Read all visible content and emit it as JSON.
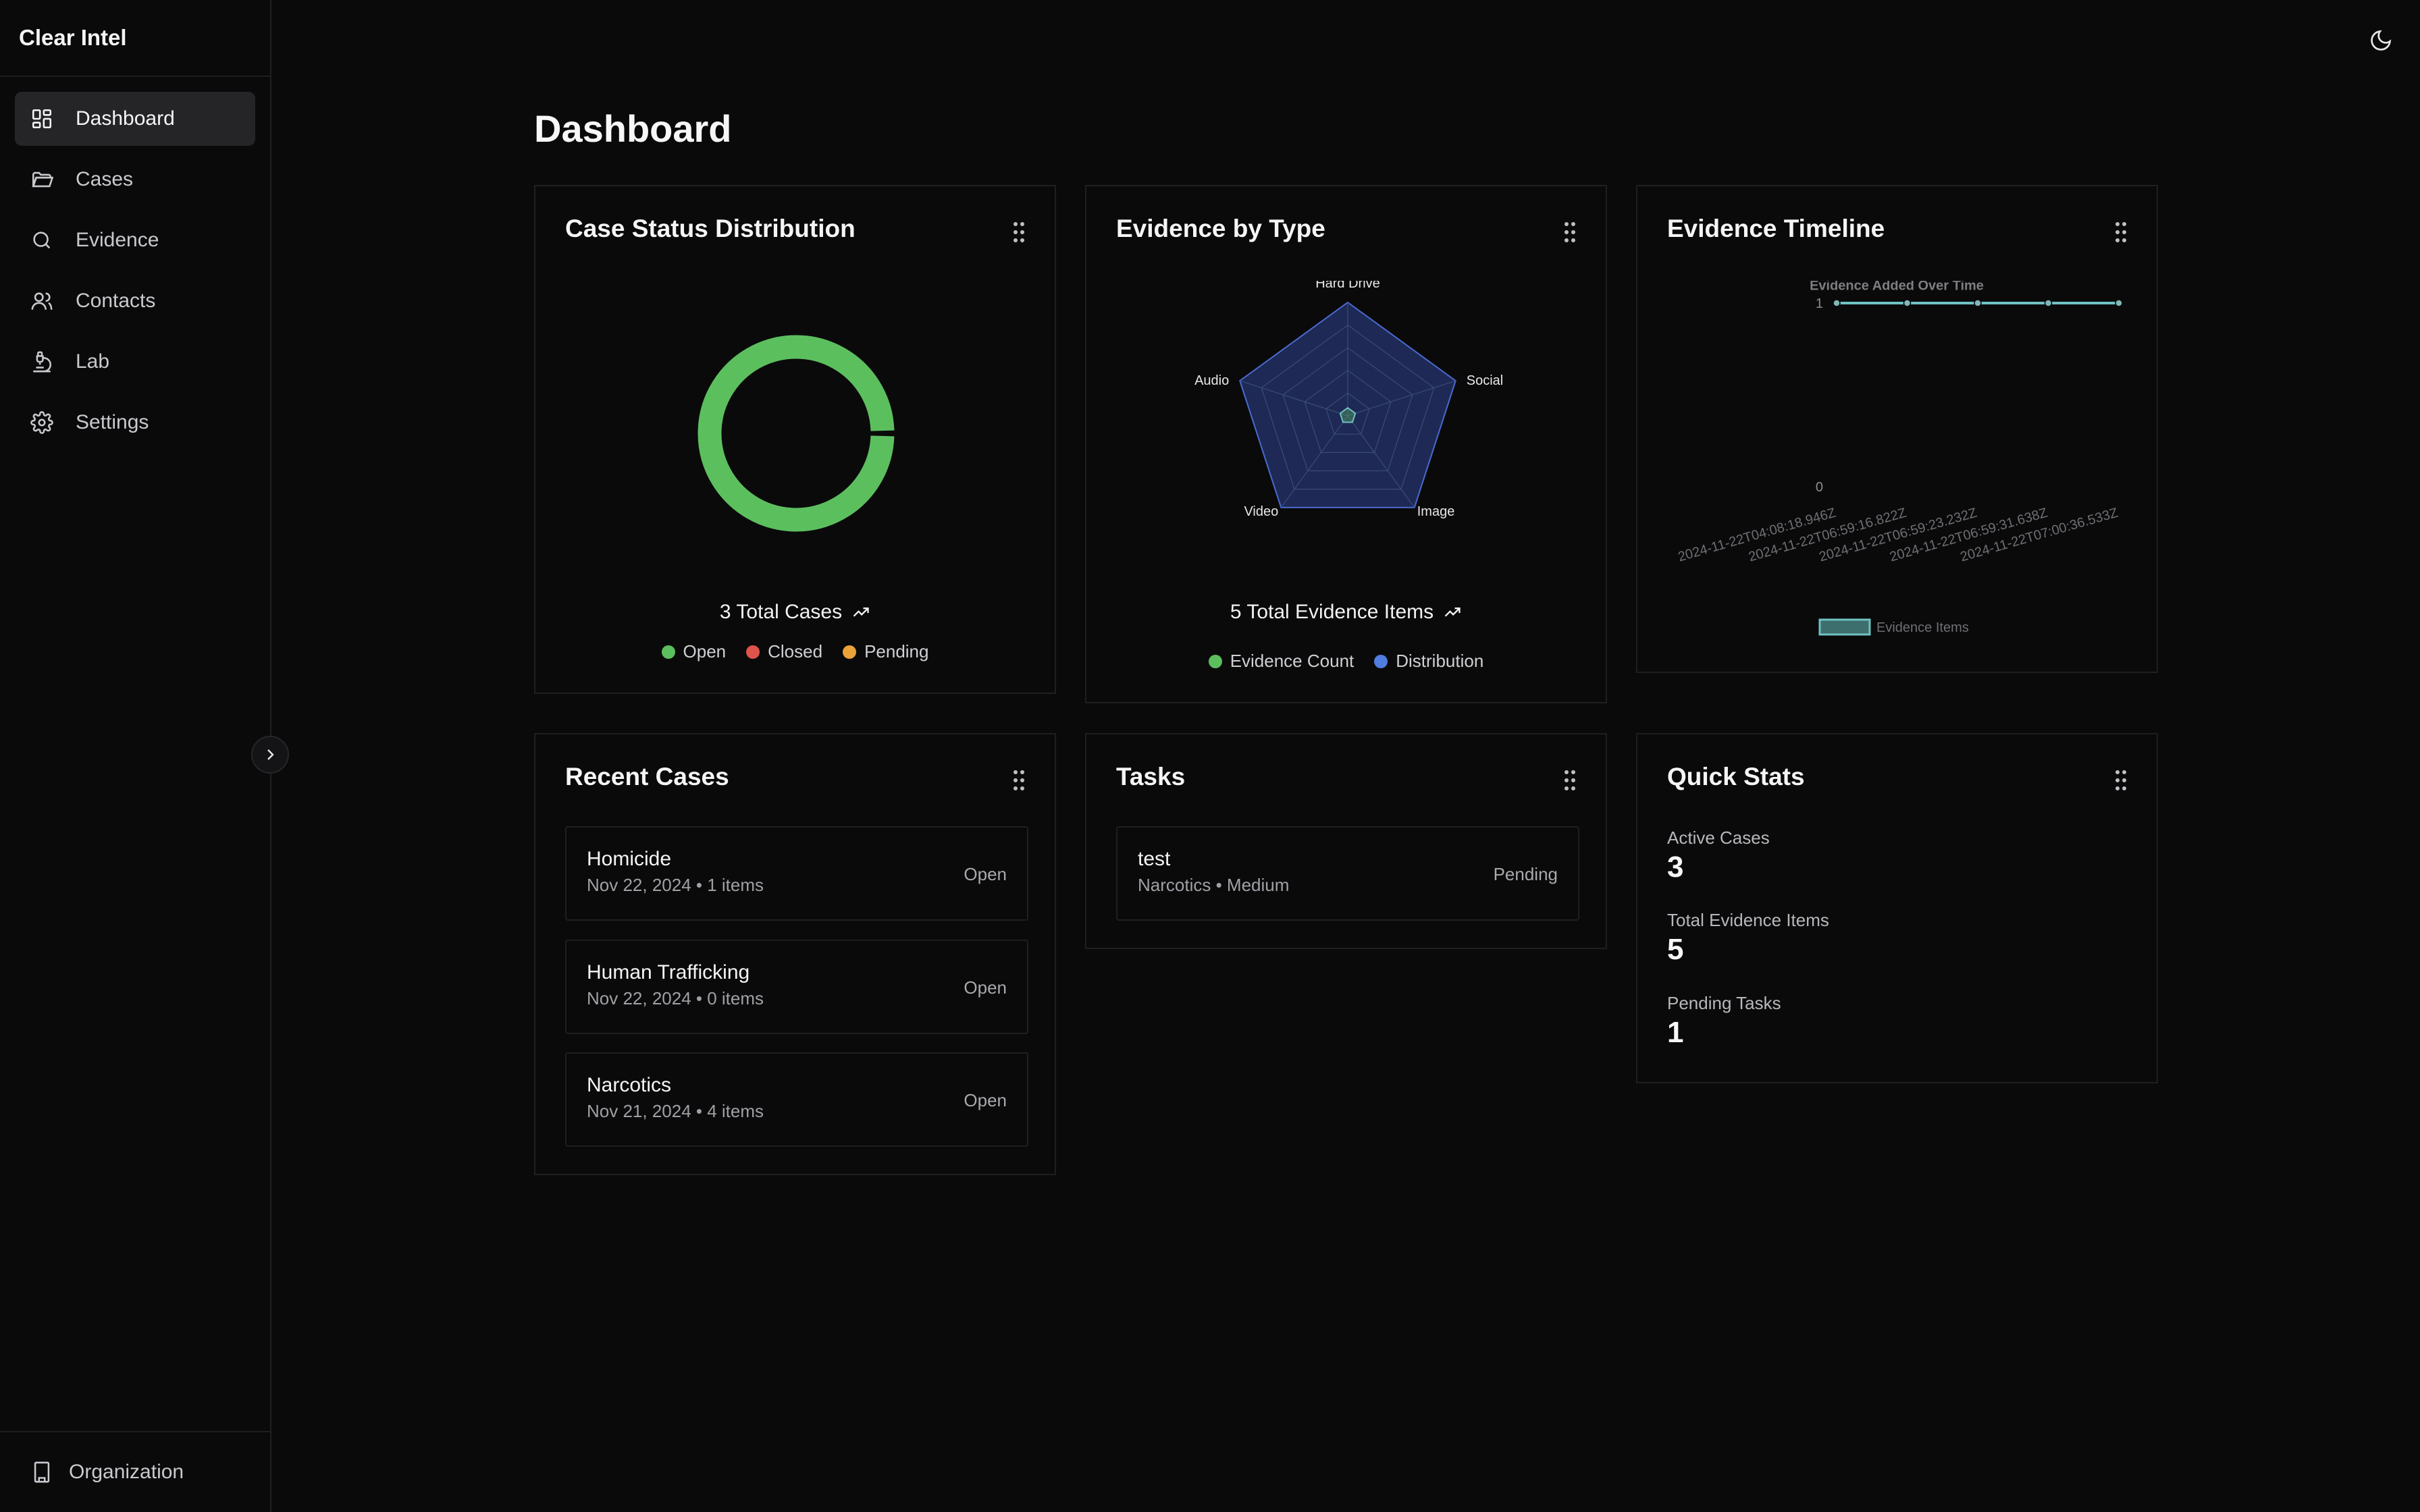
{
  "app": {
    "title": "Clear Intel"
  },
  "sidebar": {
    "items": [
      {
        "label": "Dashboard",
        "icon": "dashboard-icon",
        "active": true
      },
      {
        "label": "Cases",
        "icon": "folder-icon"
      },
      {
        "label": "Evidence",
        "icon": "search-icon"
      },
      {
        "label": "Contacts",
        "icon": "users-icon"
      },
      {
        "label": "Lab",
        "icon": "microscope-icon"
      },
      {
        "label": "Settings",
        "icon": "gear-icon"
      }
    ],
    "footer": {
      "label": "Organization",
      "icon": "building-icon"
    }
  },
  "page": {
    "title": "Dashboard"
  },
  "colors": {
    "open": "#5cbf5e",
    "closed": "#e0534a",
    "pending": "#eaa23a",
    "evidence_count": "#5cbf5e",
    "distribution": "#4f7de0",
    "timeline": "#6fc2c2",
    "radar_fill": "#1e2a55",
    "radar_stroke": "#4a6ad0"
  },
  "case_status": {
    "title": "Case Status Distribution",
    "total_label": "3 Total Cases",
    "legend": [
      "Open",
      "Closed",
      "Pending"
    ]
  },
  "evidence_type": {
    "title": "Evidence by Type",
    "total_label": "5 Total Evidence Items",
    "legend": [
      "Evidence Count",
      "Distribution"
    ]
  },
  "timeline": {
    "title": "Evidence Timeline",
    "chart_title": "Evidence Added Over Time",
    "legend_label": "Evidence Items"
  },
  "chart_data": [
    {
      "type": "pie",
      "title": "",
      "categories": [
        "Open",
        "Closed",
        "Pending"
      ],
      "values": [
        3,
        0,
        0
      ]
    },
    {
      "type": "radar",
      "title": "",
      "categories": [
        "Hard Drive",
        "Social",
        "Image",
        "Video",
        "Audio"
      ],
      "series": [
        {
          "name": "Evidence Count",
          "values": [
            0,
            0,
            0,
            0,
            0
          ]
        },
        {
          "name": "Distribution",
          "values": [
            1,
            1,
            1,
            1,
            1
          ]
        }
      ]
    },
    {
      "type": "line",
      "title": "Evidence Added Over Time",
      "x": [
        "2024-11-22T04:08:18.946Z",
        "2024-11-22T06:59:16.822Z",
        "2024-11-22T06:59:23.232Z",
        "2024-11-22T06:59:31.638Z",
        "2024-11-22T07:00:36.533Z"
      ],
      "series": [
        {
          "name": "Evidence Items",
          "values": [
            1,
            1,
            1,
            1,
            1
          ]
        }
      ],
      "yticks": [
        "0",
        "1"
      ],
      "ylim": [
        0,
        1
      ],
      "legend": "bottom"
    }
  ],
  "recent_cases": {
    "title": "Recent Cases",
    "rows": [
      {
        "title": "Homicide",
        "subtitle": "Nov 22, 2024 • 1 items",
        "status": "Open"
      },
      {
        "title": "Human Trafficking",
        "subtitle": "Nov 22, 2024 • 0 items",
        "status": "Open"
      },
      {
        "title": "Narcotics",
        "subtitle": "Nov 21, 2024 • 4 items",
        "status": "Open"
      }
    ]
  },
  "tasks": {
    "title": "Tasks",
    "rows": [
      {
        "title": "test",
        "subtitle": "Narcotics • Medium",
        "status": "Pending"
      }
    ]
  },
  "quick_stats": {
    "title": "Quick Stats",
    "items": [
      {
        "label": "Active Cases",
        "value": "3"
      },
      {
        "label": "Total Evidence Items",
        "value": "5"
      },
      {
        "label": "Pending Tasks",
        "value": "1"
      }
    ]
  }
}
